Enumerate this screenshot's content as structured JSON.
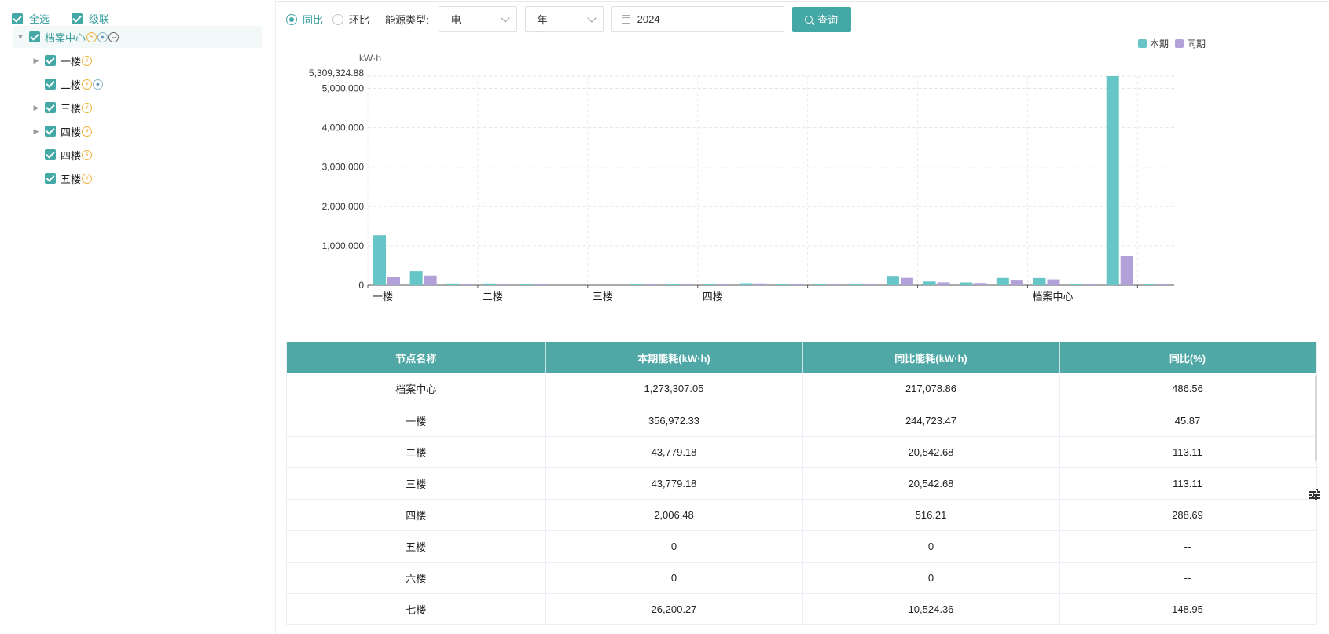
{
  "sidebar": {
    "select_all_label": "全选",
    "cascade_label": "级联",
    "root": {
      "label": "档案中心",
      "icons": [
        "electricity-icon",
        "water-icon",
        "more-icon"
      ]
    },
    "children": [
      {
        "label": "一楼",
        "expandable": true,
        "icons": [
          "electricity-icon"
        ]
      },
      {
        "label": "二楼",
        "expandable": false,
        "icons": [
          "electricity-icon",
          "water-icon"
        ]
      },
      {
        "label": "三楼",
        "expandable": true,
        "icons": [
          "electricity-icon"
        ]
      },
      {
        "label": "四楼",
        "expandable": true,
        "icons": [
          "electricity-icon"
        ]
      },
      {
        "label": "四楼",
        "expandable": false,
        "icons": [
          "electricity-icon"
        ]
      },
      {
        "label": "五楼",
        "expandable": false,
        "icons": [
          "electricity-icon"
        ]
      }
    ]
  },
  "toolbar": {
    "yoy_label": "同比",
    "mom_label": "环比",
    "energy_type_label": "能源类型:",
    "energy_type_value": "电",
    "period_value": "年",
    "date_value": "2024",
    "query_label": "查询"
  },
  "chart_data": {
    "type": "bar",
    "ylabel": "kW·h",
    "max_label": "5,309,324.88",
    "ylim": [
      0,
      5309324.88
    ],
    "yticks": [
      0,
      1000000,
      2000000,
      3000000,
      4000000,
      5000000
    ],
    "ytick_labels": [
      "0",
      "1,000,000",
      "2,000,000",
      "3,000,000",
      "4,000,000",
      "5,000,000"
    ],
    "group_labels": [
      "一楼",
      "二楼",
      "三楼",
      "四楼",
      "档案中心"
    ],
    "legend_position": "top-right",
    "series": [
      {
        "name": "本期",
        "color": "#66c5c7",
        "values": [
          1273307,
          356972,
          43779,
          43779,
          2006,
          0,
          0,
          26200,
          26200,
          30000,
          50000,
          3000,
          12000,
          19000,
          235000,
          94000,
          70000,
          184000,
          182000,
          28000,
          5309324.88,
          15000
        ]
      },
      {
        "name": "同期",
        "color": "#b1a1d8",
        "values": [
          217078,
          244723,
          20542,
          20542,
          516,
          0,
          0,
          10524,
          10524,
          15000,
          45000,
          1500,
          8000,
          12000,
          186000,
          72000,
          56000,
          118000,
          148000,
          12000,
          738000,
          12000
        ]
      }
    ]
  },
  "table": {
    "columns": [
      "节点名称",
      "本期能耗(kW·h)",
      "同比能耗(kW·h)",
      "同比(%)"
    ],
    "rows": [
      [
        "档案中心",
        "1,273,307.05",
        "217,078.86",
        "486.56"
      ],
      [
        "一楼",
        "356,972.33",
        "244,723.47",
        "45.87"
      ],
      [
        "二楼",
        "43,779.18",
        "20,542.68",
        "113.11"
      ],
      [
        "三楼",
        "43,779.18",
        "20,542.68",
        "113.11"
      ],
      [
        "四楼",
        "2,006.48",
        "516.21",
        "288.69"
      ],
      [
        "五楼",
        "0",
        "0",
        "--"
      ],
      [
        "六楼",
        "0",
        "0",
        "--"
      ],
      [
        "七楼",
        "26,200.27",
        "10,524.36",
        "148.95"
      ]
    ]
  }
}
